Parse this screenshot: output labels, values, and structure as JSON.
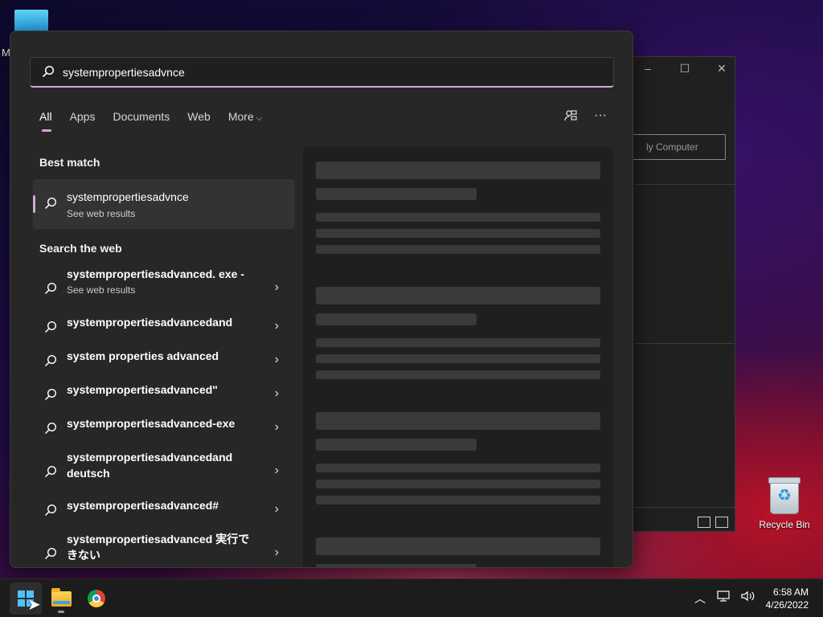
{
  "desktop": {
    "partial_label": "M",
    "recycle_bin_label": "Recycle Bin"
  },
  "background_window": {
    "button_label": "ly Computer",
    "minimize_glyph": "–",
    "maximize_glyph": "☐",
    "close_glyph": "✕"
  },
  "search": {
    "query": "systempropertiesadvnce",
    "tabs": [
      {
        "label": "All",
        "active": true
      },
      {
        "label": "Apps",
        "active": false
      },
      {
        "label": "Documents",
        "active": false
      },
      {
        "label": "Web",
        "active": false
      },
      {
        "label": "More",
        "active": false
      }
    ],
    "icons": [
      "people-search-icon",
      "more-options-icon"
    ],
    "more_options_glyph": "···",
    "best_match": {
      "heading": "Best match",
      "title": "systempropertiesadvnce",
      "subtitle": "See web results"
    },
    "search_web": {
      "heading": "Search the web",
      "items": [
        {
          "label": "systempropertiesadvanced. exe -",
          "sub": "See web results"
        },
        {
          "label": "systempropertiesadvancedand",
          "sub": ""
        },
        {
          "label": "system properties advanced",
          "sub": ""
        },
        {
          "label": "systempropertiesadvanced\"",
          "sub": ""
        },
        {
          "label": "systempropertiesadvanced-exe",
          "sub": ""
        },
        {
          "label": "systempropertiesadvancedand deutsch",
          "sub": ""
        },
        {
          "label": "systempropertiesadvanced#",
          "sub": ""
        },
        {
          "label": "systempropertiesadvanced 実行できない",
          "sub": ""
        }
      ]
    }
  },
  "taskbar": {
    "apps": [
      "start-button",
      "file-explorer",
      "chrome"
    ],
    "tray_icons": [
      "chevron-up-icon",
      "network-icon",
      "volume-icon"
    ],
    "time": "6:58 AM",
    "date": "4/26/2022"
  },
  "colors": {
    "accent": "#d4a5d8",
    "panel_bg": "#272727",
    "taskbar_bg": "#1c1c1c"
  }
}
